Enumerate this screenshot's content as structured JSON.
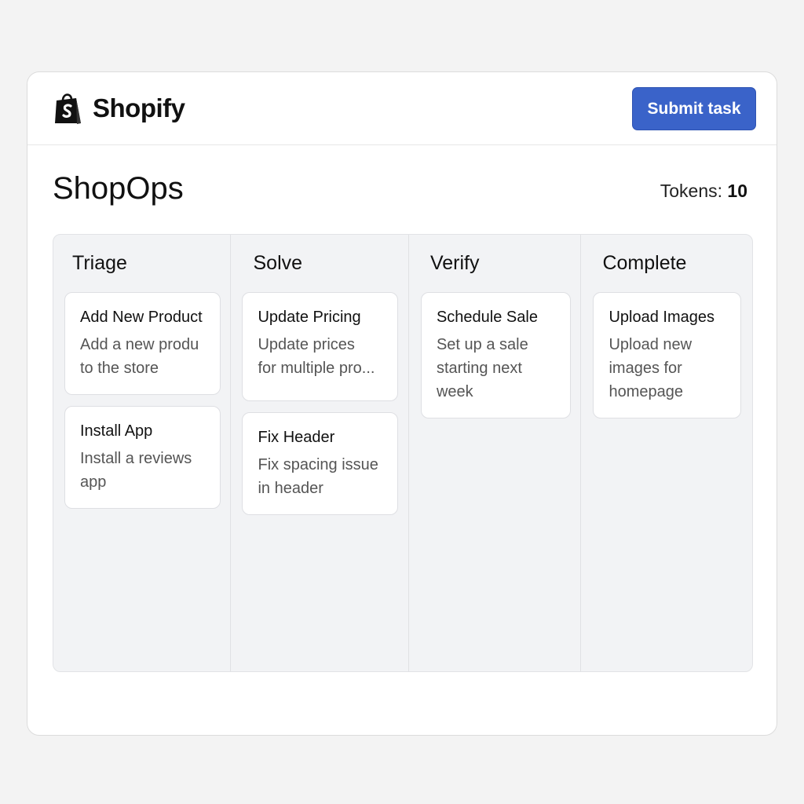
{
  "header": {
    "brand_name": "Shopify",
    "submit_label": "Submit task"
  },
  "page": {
    "title": "ShopOps",
    "tokens_label": "Tokens:",
    "tokens_value": "10"
  },
  "colors": {
    "accent": "#3a63c9",
    "board_bg": "#f2f3f5",
    "logo_green": "#000000"
  },
  "columns": [
    {
      "title": "Triage",
      "cards": [
        {
          "title": "Add New Product",
          "desc_line1": "Add a new produ",
          "desc_line2": "to the store",
          "desc_line3": ""
        },
        {
          "title": "Install App",
          "desc_line1": "Install a reviews",
          "desc_line2": "app",
          "desc_line3": ""
        }
      ]
    },
    {
      "title": "Solve",
      "cards": [
        {
          "title": "Update Pricing",
          "desc_line1": "Update prices",
          "desc_line2": "for multiple pro...",
          "desc_line3": ""
        },
        {
          "title": "Fix Header",
          "desc_line1": "Fix spacing issue",
          "desc_line2": "in header",
          "desc_line3": ""
        }
      ]
    },
    {
      "title": "Verify",
      "cards": [
        {
          "title": "Schedule Sale",
          "desc_line1": "Set up a sale",
          "desc_line2": "starting next",
          "desc_line3": "week"
        }
      ]
    },
    {
      "title": "Complete",
      "cards": [
        {
          "title": "Upload Images",
          "desc_line1": "Upload new",
          "desc_line2": "images for",
          "desc_line3": "homepage"
        }
      ]
    }
  ]
}
